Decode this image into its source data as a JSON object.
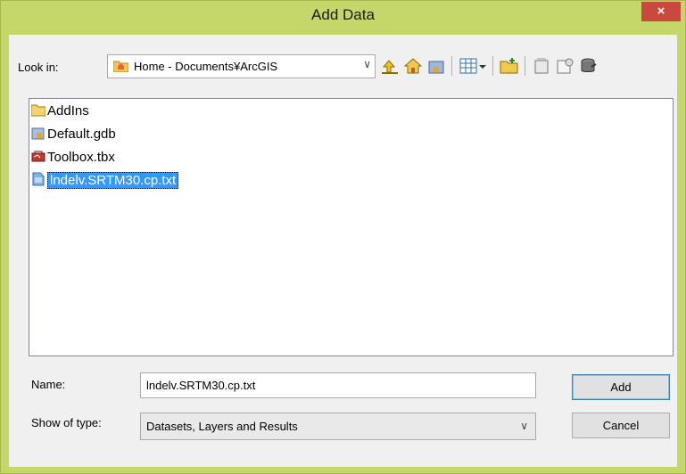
{
  "window": {
    "title": "Add Data",
    "close_label": "×"
  },
  "lookin": {
    "label": "Look in:",
    "value": "Home - Documents¥ArcGIS"
  },
  "toolbar": {
    "icons": [
      "up-one-level-icon",
      "home-icon",
      "connect-folder-icon",
      "view-menu-icon",
      "new-folder-icon",
      "new-geodatabase-icon",
      "new-layer-icon",
      "connect-database-icon"
    ]
  },
  "files": [
    {
      "name": "AddIns",
      "icon": "folder-icon"
    },
    {
      "name": "Default.gdb",
      "icon": "geodatabase-icon"
    },
    {
      "name": "Toolbox.tbx",
      "icon": "toolbox-icon"
    },
    {
      "name": "lndelv.SRTM30.cp.txt",
      "icon": "text-file-icon",
      "selected": true
    }
  ],
  "name_field": {
    "label": "Name:",
    "value": "lndelv.SRTM30.cp.txt"
  },
  "type_field": {
    "label": "Show of type:",
    "value": "Datasets, Layers and Results"
  },
  "buttons": {
    "add": "Add",
    "cancel": "Cancel"
  },
  "colors": {
    "frame": "#c5d66a",
    "close": "#c94a3c",
    "selection": "#3399ff"
  }
}
